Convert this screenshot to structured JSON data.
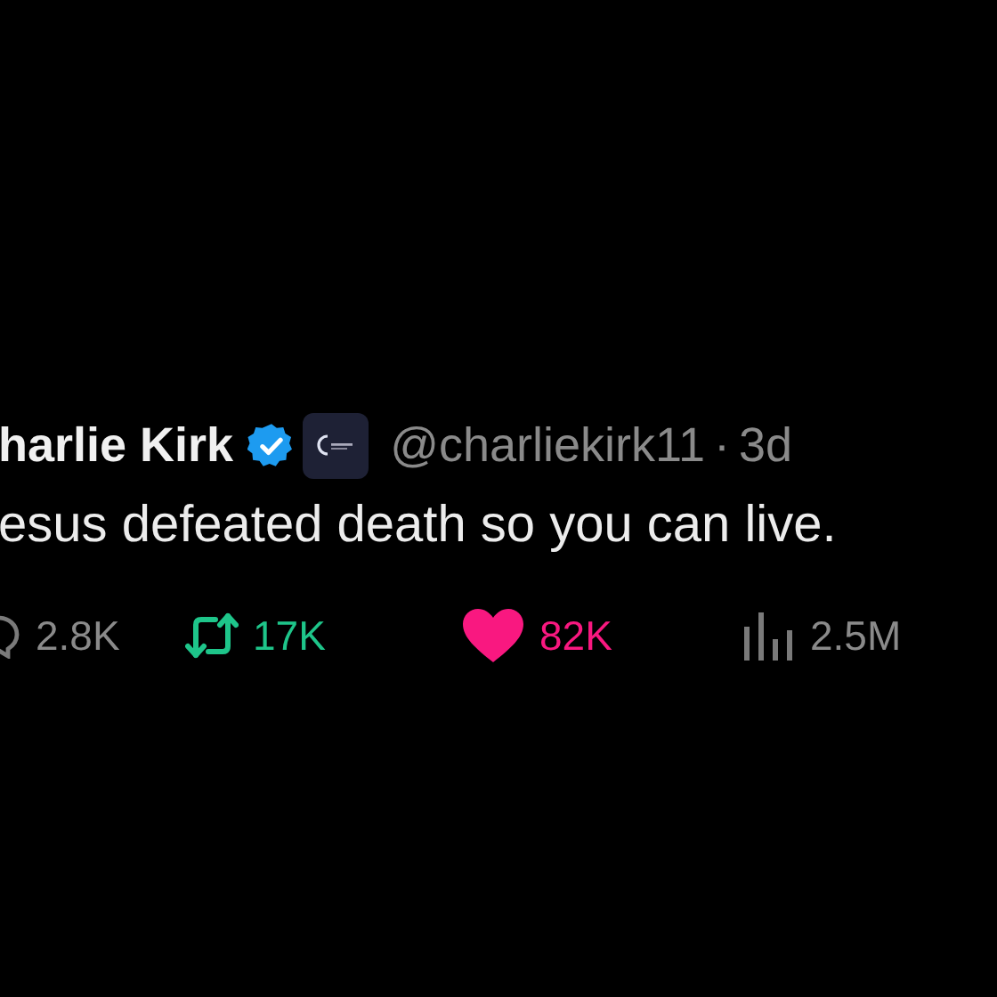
{
  "tweet": {
    "name": "harlie Kirk",
    "verified": true,
    "handle": "@charliekirk11",
    "separator": "·",
    "time": "3d",
    "text": "esus defeated death so you can live.",
    "actions": [
      {
        "kind": "reply",
        "count": "2.8K",
        "active": false
      },
      {
        "kind": "repost",
        "count": "17K",
        "active": true
      },
      {
        "kind": "like",
        "count": "82K",
        "active": true
      },
      {
        "kind": "views",
        "count": "2.5M",
        "active": false
      }
    ]
  }
}
